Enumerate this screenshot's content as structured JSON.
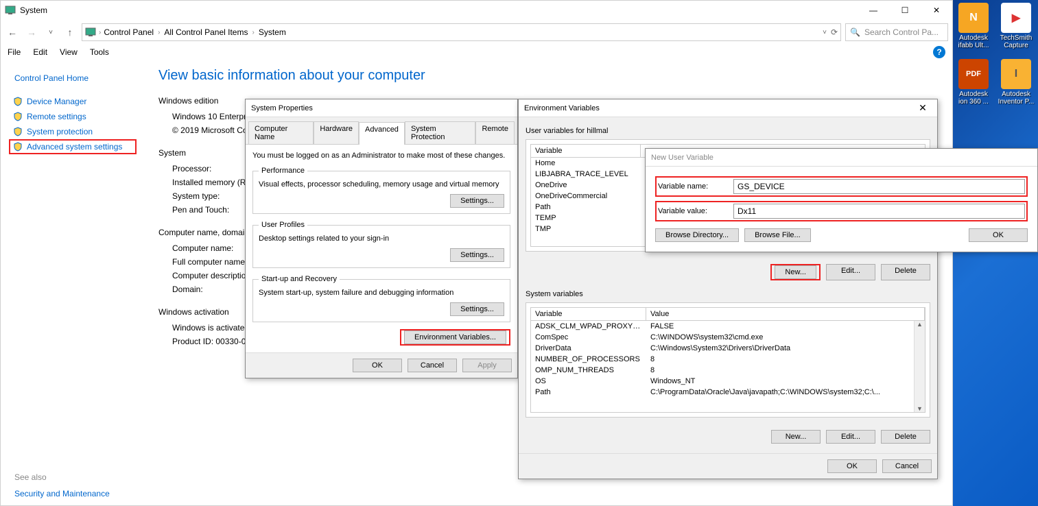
{
  "window": {
    "title": "System",
    "breadcrumbs": [
      "Control Panel",
      "All Control Panel Items",
      "System"
    ],
    "search_placeholder": "Search Control Pa..."
  },
  "menubar": [
    "File",
    "Edit",
    "View",
    "Tools"
  ],
  "sidebar": {
    "home": "Control Panel Home",
    "links": [
      "Device Manager",
      "Remote settings",
      "System protection",
      "Advanced system settings"
    ],
    "seealso_label": "See also",
    "seealso": "Security and Maintenance"
  },
  "main": {
    "heading": "View basic information about your computer",
    "groups": {
      "edition_label": "Windows edition",
      "edition_rows": [
        "Windows 10 Enterprise",
        "© 2019 Microsoft Corp"
      ],
      "system_label": "System",
      "system_rows": [
        "Processor:",
        "Installed memory (RAM",
        "System type:",
        "Pen and Touch:"
      ],
      "cname_label": "Computer name, domain",
      "cname_rows": [
        "Computer name:",
        "Full computer name:",
        "Computer description",
        "Domain:"
      ],
      "act_label": "Windows activation",
      "act_rows": [
        "Windows is activated",
        "Product ID: 00330-000"
      ]
    }
  },
  "sysprops": {
    "title": "System Properties",
    "tabs": [
      "Computer Name",
      "Hardware",
      "Advanced",
      "System Protection",
      "Remote"
    ],
    "note": "You must be logged on as an Administrator to make most of these changes.",
    "perf": {
      "legend": "Performance",
      "desc": "Visual effects, processor scheduling, memory usage and virtual memory",
      "btn": "Settings..."
    },
    "profiles": {
      "legend": "User Profiles",
      "desc": "Desktop settings related to your sign-in",
      "btn": "Settings..."
    },
    "startup": {
      "legend": "Start-up and Recovery",
      "desc": "System start-up, system failure and debugging information",
      "btn": "Settings..."
    },
    "envbtn": "Environment Variables...",
    "ok": "OK",
    "cancel": "Cancel",
    "apply": "Apply"
  },
  "envvars": {
    "title": "Environment Variables",
    "user_label": "User variables for hillmal",
    "col_var": "Variable",
    "col_val": "Value",
    "user_vars": [
      "Home",
      "LIBJABRA_TRACE_LEVEL",
      "OneDrive",
      "OneDriveCommercial",
      "Path",
      "TEMP",
      "TMP"
    ],
    "new": "New...",
    "edit": "Edit...",
    "delete": "Delete",
    "sys_label": "System variables",
    "sys_vars": [
      {
        "n": "ADSK_CLM_WPAD_PROXY_...",
        "v": "FALSE"
      },
      {
        "n": "ComSpec",
        "v": "C:\\WINDOWS\\system32\\cmd.exe"
      },
      {
        "n": "DriverData",
        "v": "C:\\Windows\\System32\\Drivers\\DriverData"
      },
      {
        "n": "NUMBER_OF_PROCESSORS",
        "v": "8"
      },
      {
        "n": "OMP_NUM_THREADS",
        "v": "8"
      },
      {
        "n": "OS",
        "v": "Windows_NT"
      },
      {
        "n": "Path",
        "v": "C:\\ProgramData\\Oracle\\Java\\javapath;C:\\WINDOWS\\system32;C:\\..."
      }
    ],
    "ok": "OK",
    "cancel": "Cancel"
  },
  "newvar": {
    "title": "New User Variable",
    "name_label": "Variable name:",
    "name_value": "GS_DEVICE",
    "value_label": "Variable value:",
    "value_value": "Dx11",
    "browse_dir": "Browse Directory...",
    "browse_file": "Browse File...",
    "ok": "OK"
  },
  "desktop_icons": [
    {
      "name": "Autodesk ifabb Ult...",
      "bg": "#f6a623",
      "fg": "#fff",
      "glyph": "N"
    },
    {
      "name": "TechSmith Capture",
      "bg": "#fff",
      "fg": "#d33",
      "glyph": "▶"
    },
    {
      "name": "Autodesk ion 360 ...",
      "bg": "#c40",
      "fg": "#fff",
      "glyph": "PDF"
    },
    {
      "name": "Autodesk Inventor P...",
      "bg": "#f9b233",
      "fg": "#8a4",
      "glyph": "I"
    }
  ]
}
